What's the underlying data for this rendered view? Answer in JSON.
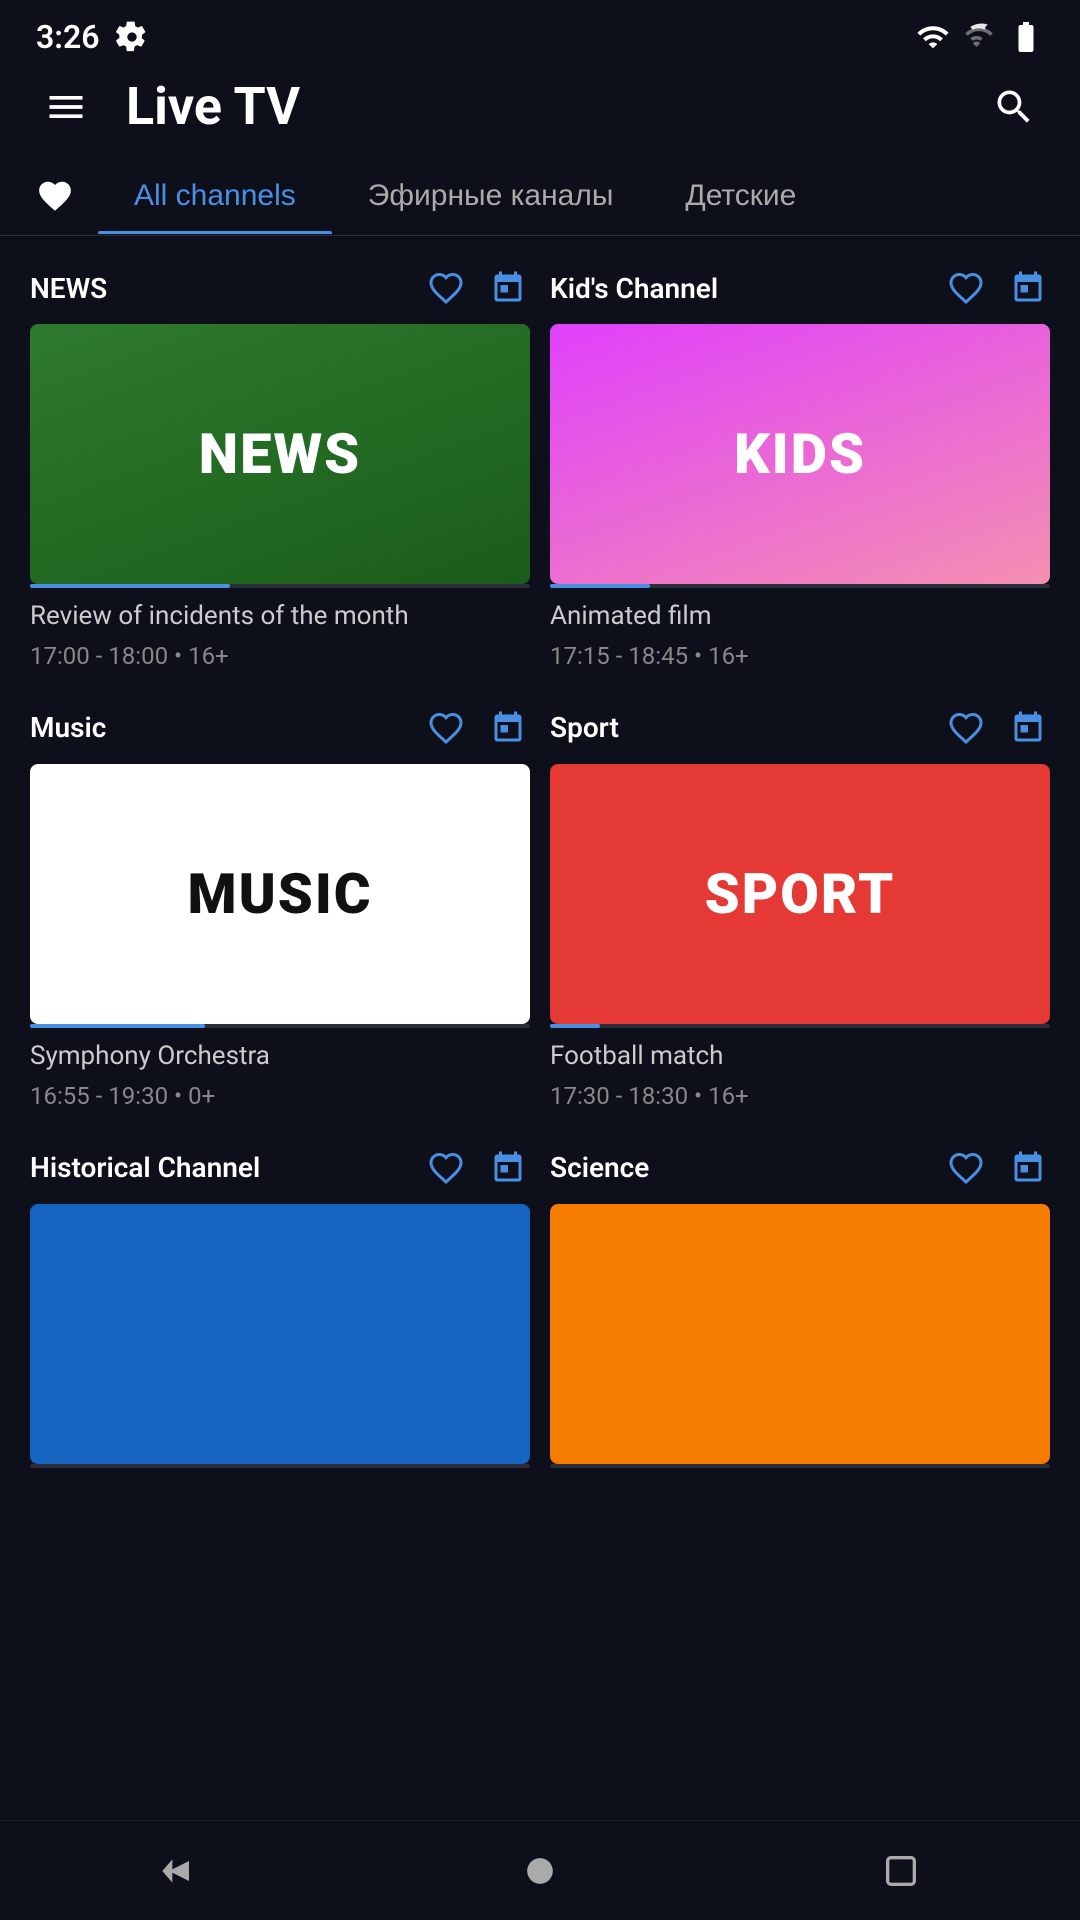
{
  "statusBar": {
    "time": "3:26",
    "settingsIcon": "gear-icon"
  },
  "topBar": {
    "menuIcon": "menu-icon",
    "title": "Live TV",
    "searchIcon": "search-icon"
  },
  "tabs": {
    "favoriteIcon": "heart-icon",
    "items": [
      {
        "id": "all",
        "label": "All channels",
        "active": true
      },
      {
        "id": "air",
        "label": "Эфирные каналы",
        "active": false
      },
      {
        "id": "kids",
        "label": "Детские",
        "active": false
      }
    ]
  },
  "channels": [
    {
      "id": "news",
      "name": "NEWS",
      "thumbnail_label": "NEWS",
      "thumbnail_class": "news-bg",
      "program_title": "Review of incidents of the month",
      "program_time": "17:00 - 18:00",
      "rating": "16+",
      "progress": 40
    },
    {
      "id": "kids",
      "name": "Kid's Channel",
      "thumbnail_label": "KIDS",
      "thumbnail_class": "kids-bg",
      "program_title": "Animated film",
      "program_time": "17:15 - 18:45",
      "rating": "16+",
      "progress": 20
    },
    {
      "id": "music",
      "name": "Music",
      "thumbnail_label": "MUSIC",
      "thumbnail_class": "music-bg",
      "program_title": "Symphony Orchestra",
      "program_time": "16:55 - 19:30",
      "rating": "0+",
      "progress": 35
    },
    {
      "id": "sport",
      "name": "Sport",
      "thumbnail_label": "SPORT",
      "thumbnail_class": "sport-bg",
      "program_title": "Football match",
      "program_time": "17:30 - 18:30",
      "rating": "16+",
      "progress": 10
    },
    {
      "id": "history",
      "name": "Historical Channel",
      "thumbnail_label": "",
      "thumbnail_class": "history-bg",
      "program_title": "",
      "program_time": "",
      "rating": "",
      "progress": 0
    },
    {
      "id": "science",
      "name": "Science",
      "thumbnail_label": "",
      "thumbnail_class": "science-bg",
      "program_title": "",
      "program_time": "",
      "rating": "",
      "progress": 0
    }
  ],
  "bottomNav": {
    "backIcon": "back-icon",
    "homeIcon": "home-icon",
    "squareIcon": "square-icon"
  }
}
